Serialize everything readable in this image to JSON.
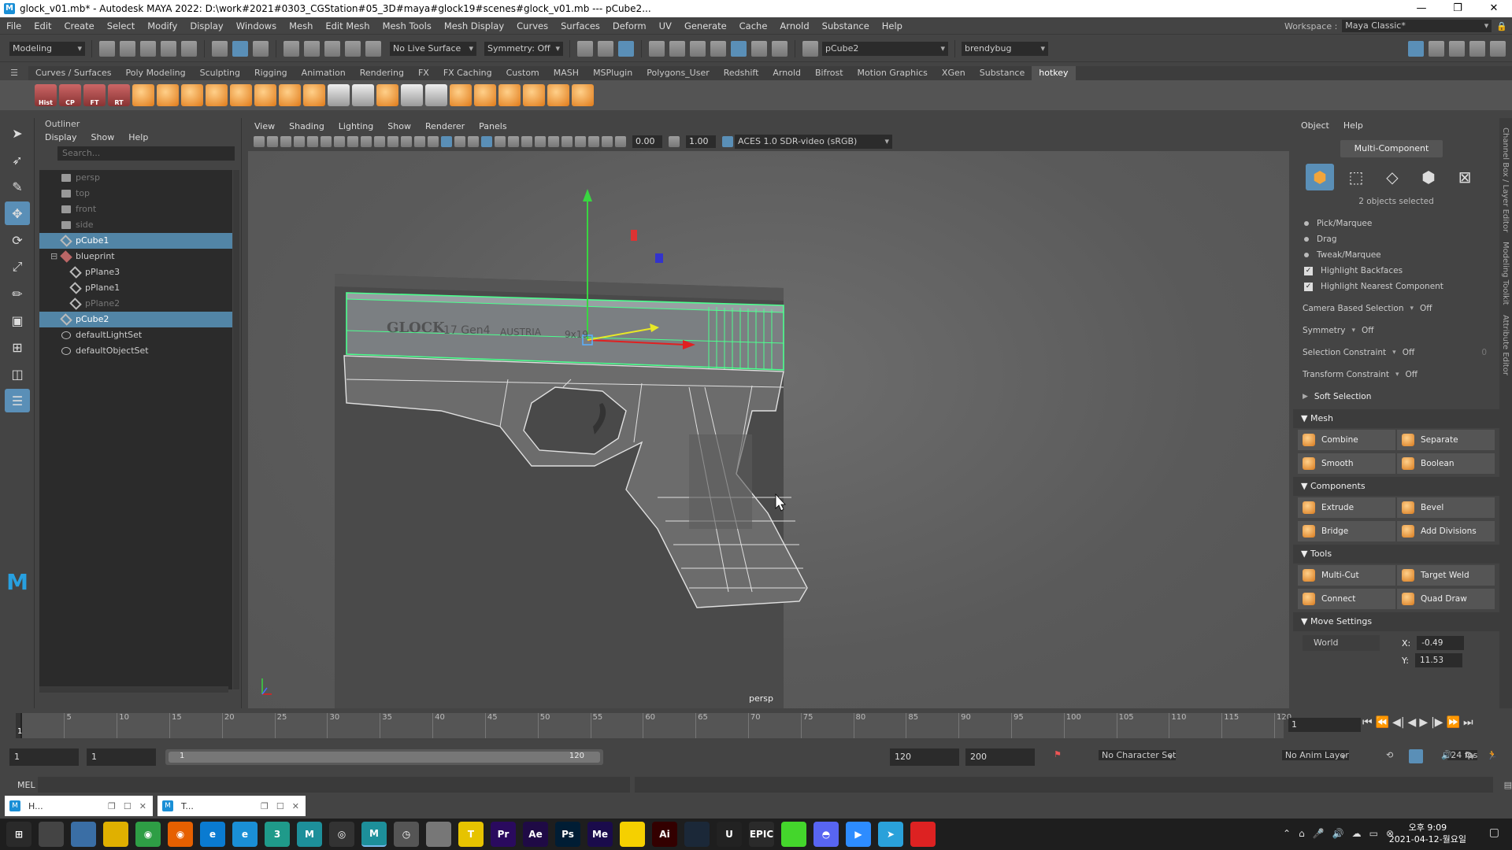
{
  "window": {
    "title": "glock_v01.mb* - Autodesk MAYA 2022: D:\\work#2021#0303_CGStation#05_3D#maya#glock19#scenes#glock_v01.mb   ---   pCube2...",
    "app_icon": "M"
  },
  "menubar": [
    "File",
    "Edit",
    "Create",
    "Select",
    "Modify",
    "Display",
    "Windows",
    "Mesh",
    "Edit Mesh",
    "Mesh Tools",
    "Mesh Display",
    "Curves",
    "Surfaces",
    "Deform",
    "UV",
    "Generate",
    "Cache",
    "Arnold",
    "Substance",
    "Help"
  ],
  "workspace": {
    "label": "Workspace :",
    "value": "Maya Classic*"
  },
  "status": {
    "menuset": "Modeling",
    "live_surface": "No Live Surface",
    "symmetry": "Symmetry: Off",
    "object_name": "pCube2",
    "user": "brendybug"
  },
  "shelf_tabs": [
    "Curves / Surfaces",
    "Poly Modeling",
    "Sculpting",
    "Rigging",
    "Animation",
    "Rendering",
    "FX",
    "FX Caching",
    "Custom",
    "MASH",
    "MSPlugin",
    "Polygons_User",
    "Redshift",
    "Arnold",
    "Bifrost",
    "Motion Graphics",
    "XGen",
    "Substance",
    "hotkey"
  ],
  "shelf_active": "hotkey",
  "shelf_labels": [
    "Hist",
    "CP",
    "FT",
    "RT"
  ],
  "outliner": {
    "title": "Outliner",
    "menu": [
      "Display",
      "Show",
      "Help"
    ],
    "search_placeholder": "Search...",
    "items": [
      {
        "label": "persp",
        "type": "camera",
        "dim": true,
        "indent": 0
      },
      {
        "label": "top",
        "type": "camera",
        "dim": true,
        "indent": 0
      },
      {
        "label": "front",
        "type": "camera",
        "dim": true,
        "indent": 0
      },
      {
        "label": "side",
        "type": "camera",
        "dim": true,
        "indent": 0
      },
      {
        "label": "pCube1",
        "type": "mesh",
        "selected": true,
        "indent": 0
      },
      {
        "label": "blueprint",
        "type": "group",
        "indent": 0,
        "expander": "−"
      },
      {
        "label": "pPlane3",
        "type": "mesh",
        "indent": 1
      },
      {
        "label": "pPlane1",
        "type": "mesh",
        "indent": 1
      },
      {
        "label": "pPlane2",
        "type": "mesh",
        "dim": true,
        "indent": 1
      },
      {
        "label": "pCube2",
        "type": "mesh",
        "selected": true,
        "indent": 0
      },
      {
        "label": "defaultLightSet",
        "type": "set",
        "indent": 0
      },
      {
        "label": "defaultObjectSet",
        "type": "set",
        "indent": 0
      }
    ]
  },
  "viewport": {
    "menu": [
      "View",
      "Shading",
      "Lighting",
      "Show",
      "Renderer",
      "Panels"
    ],
    "exposure": "0.00",
    "gamma": "1.00",
    "color_space": "ACES 1.0 SDR-video (sRGB)",
    "camera_label": "persp",
    "slide_text": [
      "GLOCK",
      "17 Gen4",
      "AUSTRIA",
      "9x19"
    ]
  },
  "attr": {
    "menu": [
      "Object",
      "Help"
    ],
    "mode_button": "Multi-Component",
    "selection_count": "2 objects selected",
    "pick": [
      "Pick/Marquee",
      "Drag",
      "Tweak/Marquee"
    ],
    "checks": [
      "Highlight Backfaces",
      "Highlight Nearest Component"
    ],
    "settings": [
      {
        "label": "Camera Based Selection",
        "value": "Off"
      },
      {
        "label": "Symmetry",
        "value": "Off"
      },
      {
        "label": "Selection Constraint",
        "value": "Off",
        "extra": "0"
      },
      {
        "label": "Transform Constraint",
        "value": "Off"
      }
    ],
    "soft_selection": "Soft Selection",
    "sections": [
      {
        "title": "Mesh",
        "buttons": [
          [
            "Combine",
            "Separate"
          ],
          [
            "Smooth",
            "Boolean"
          ]
        ]
      },
      {
        "title": "Components",
        "buttons": [
          [
            "Extrude",
            "Bevel"
          ],
          [
            "Bridge",
            "Add Divisions"
          ]
        ]
      },
      {
        "title": "Tools",
        "buttons": [
          [
            "Multi-Cut",
            "Target Weld"
          ],
          [
            "Connect",
            "Quad Draw"
          ]
        ]
      }
    ],
    "move_settings": {
      "title": "Move Settings",
      "space": "World",
      "x_label": "X:",
      "x": "-0.49",
      "y_label": "Y:",
      "y": "11.53"
    }
  },
  "side_tabs": [
    "Channel Box / Layer Editor",
    "Modeling Toolkit",
    "Attribute Editor"
  ],
  "timeline": {
    "ticks": [
      5,
      10,
      15,
      20,
      25,
      30,
      35,
      40,
      45,
      50,
      55,
      60,
      65,
      70,
      75,
      80,
      85,
      90,
      95,
      100,
      105,
      110,
      115,
      120
    ],
    "start": 1,
    "end": 120,
    "current": "1",
    "current_tick": "1"
  },
  "range": {
    "start": "1",
    "anim_start": "1",
    "bar_start": "1",
    "bar_end": "120",
    "end": "120",
    "anim_end": "200",
    "char_set": "No Character Set",
    "anim_layer": "No Anim Layer",
    "fps": "24 fps"
  },
  "cmdline": {
    "label": "MEL"
  },
  "minimized": [
    {
      "label": "H..."
    },
    {
      "label": "T..."
    }
  ],
  "taskbar": {
    "apps": [
      "start",
      "explorer",
      "calc",
      "files",
      "chrome",
      "firefox",
      "edge",
      "ie",
      "3ds",
      "maya",
      "obs",
      "maya-active",
      "clock",
      "mudbox",
      "talk",
      "premiere",
      "aftereffects",
      "photoshop",
      "mediaencoder",
      "notes",
      "illustrator",
      "steam",
      "unreal",
      "epic",
      "razer",
      "discord",
      "zoom",
      "telegram",
      "redapp"
    ],
    "time": "오후 9:09",
    "date": "2021-04-12-월요일"
  },
  "colors": {
    "accent": "#5285a6",
    "selected_mesh": "#4dff8f",
    "bg": "#444444"
  }
}
